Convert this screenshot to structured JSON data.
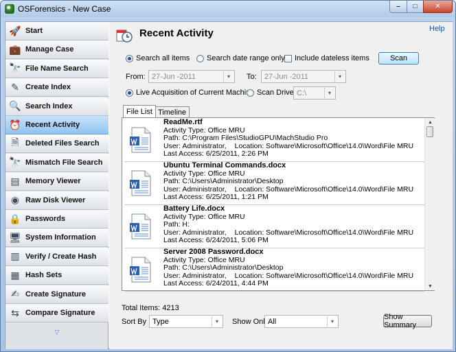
{
  "window": {
    "title": "OSForensics - New Case",
    "min": "–",
    "max": "□",
    "close": "✕"
  },
  "sidebar": {
    "items": [
      {
        "label": "Start",
        "icon": "rocket-icon",
        "glyph": "🚀",
        "active": false
      },
      {
        "label": "Manage Case",
        "icon": "briefcase-icon",
        "glyph": "💼",
        "active": false
      },
      {
        "label": "File Name Search",
        "icon": "binoculars-icon",
        "glyph": "🔭",
        "active": false
      },
      {
        "label": "Create Index",
        "icon": "pencil-icon",
        "glyph": "✎",
        "active": false
      },
      {
        "label": "Search Index",
        "icon": "magnifier-icon",
        "glyph": "🔍",
        "active": false
      },
      {
        "label": "Recent Activity",
        "icon": "clock-icon",
        "glyph": "⏰",
        "active": true
      },
      {
        "label": "Deleted Files Search",
        "icon": "deleted-file-icon",
        "glyph": "🗎",
        "active": false
      },
      {
        "label": "Mismatch File Search",
        "icon": "binoculars-icon",
        "glyph": "🔭",
        "active": false
      },
      {
        "label": "Memory Viewer",
        "icon": "memory-icon",
        "glyph": "▤",
        "active": false
      },
      {
        "label": "Raw Disk Viewer",
        "icon": "disk-icon",
        "glyph": "◉",
        "active": false
      },
      {
        "label": "Passwords",
        "icon": "lock-icon",
        "glyph": "🔒",
        "active": false
      },
      {
        "label": "System Information",
        "icon": "computer-icon",
        "glyph": "🖥",
        "active": false
      },
      {
        "label": "Verify / Create Hash",
        "icon": "barcode-icon",
        "glyph": "▥",
        "active": false
      },
      {
        "label": "Hash Sets",
        "icon": "database-icon",
        "glyph": "▦",
        "active": false
      },
      {
        "label": "Create Signature",
        "icon": "signature-icon",
        "glyph": "✍",
        "active": false
      },
      {
        "label": "Compare Signature",
        "icon": "compare-icon",
        "glyph": "⇆",
        "active": false
      }
    ],
    "scroll_down": "▽"
  },
  "header": {
    "title": "Recent Activity",
    "help": "Help"
  },
  "search": {
    "all_items": "Search all items",
    "date_range": "Search date range only",
    "include_dateless": "Include dateless items",
    "scan": "Scan",
    "from_label": "From:",
    "from_value": "27-Jun -2011",
    "to_label": "To:",
    "to_value": "27-Jun -2011",
    "live": "Live Acquisition of Current Machine",
    "scan_drive": "Scan Drive:",
    "drive_value": "C:\\"
  },
  "tabs": {
    "file_list": "File List",
    "timeline": "Timeline"
  },
  "entries": [
    {
      "name": "ReadMe.rtf",
      "type": "Activity Type: Office MRU",
      "path": "Path: C:\\Program Files\\StudioGPU\\MachStudio Pro",
      "user": "User: Administrator,",
      "location": "Location: Software\\Microsoft\\Office\\14.0\\Word\\File MRU",
      "access": "Last Access: 6/25/2011, 2:26 PM"
    },
    {
      "name": "Ubuntu Terminal Commands.docx",
      "type": "Activity Type: Office MRU",
      "path": "Path: C:\\Users\\Administrator\\Desktop",
      "user": "User: Administrator,",
      "location": "Location: Software\\Microsoft\\Office\\14.0\\Word\\File MRU",
      "access": "Last Access: 6/25/2011, 1:21 PM"
    },
    {
      "name": "Battery Life.docx",
      "type": "Activity Type: Office MRU",
      "path": "Path: H:",
      "user": "User: Administrator,",
      "location": "Location: Software\\Microsoft\\Office\\14.0\\Word\\File MRU",
      "access": "Last Access: 6/24/2011, 5:06 PM"
    },
    {
      "name": "Server 2008 Password.docx",
      "type": "Activity Type: Office MRU",
      "path": "Path: C:\\Users\\Administrator\\Desktop",
      "user": "User: Administrator,",
      "location": "Location: Software\\Microsoft\\Office\\14.0\\Word\\File MRU",
      "access": "Last Access: 6/24/2011, 4:44 PM"
    }
  ],
  "footer": {
    "total": "Total Items: 4213",
    "sort_label": "Sort By",
    "sort_value": "Type",
    "show_label": "Show Only",
    "show_value": "All",
    "summary": "Show Summary"
  }
}
